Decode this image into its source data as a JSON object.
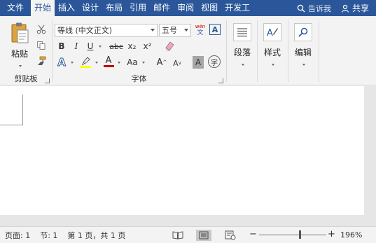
{
  "tabs": {
    "file": "文件",
    "home": "开始",
    "insert": "插入",
    "design": "设计",
    "layout": "布局",
    "references": "引用",
    "mailings": "邮件",
    "review": "审阅",
    "view": "视图",
    "developer": "开发工"
  },
  "tell_me": "告诉我",
  "share": "共享",
  "clipboard": {
    "paste_label": "粘贴",
    "group_label": "剪贴板"
  },
  "font": {
    "font_name": "等线 (中文正文)",
    "font_size": "五号",
    "group_label": "字体",
    "bold": "B",
    "italic": "I",
    "underline": "U",
    "strike": "abc",
    "subscript": "x₂",
    "superscript": "x²",
    "grow": "A",
    "shrink": "A",
    "case": "Aa",
    "shade": "A",
    "enclose": "字",
    "effects": "A",
    "font_color": "A",
    "phonetic_top": "wén",
    "phonetic_bottom": "文",
    "border_char": "A"
  },
  "paragraph": {
    "label": "段落"
  },
  "styles": {
    "label": "样式"
  },
  "editing": {
    "label": "编辑"
  },
  "status": {
    "page": "页面: 1",
    "section": "节: 1",
    "page_of": "第 1 页，共 1 页",
    "zoom_minus": "−",
    "zoom_plus": "+",
    "zoom": "196%"
  },
  "colors": {
    "accent": "#2b579a",
    "highlight": "#ffff00",
    "font_color": "#c00000"
  },
  "zoom_level_fraction": 0.6
}
